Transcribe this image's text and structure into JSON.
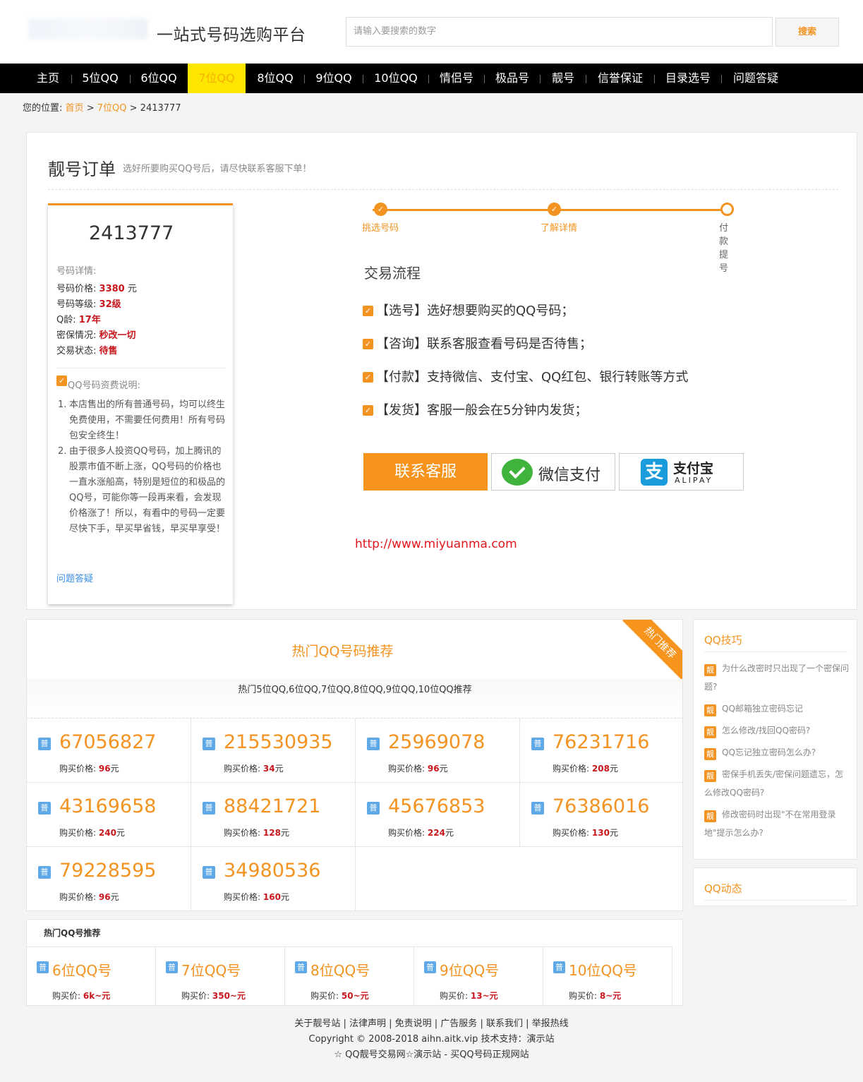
{
  "header": {
    "slogan": "一站式号码选购平台",
    "search_placeholder": "请输入要搜索的数字",
    "search_btn": "搜索"
  },
  "nav": [
    "主页",
    "5位QQ",
    "6位QQ",
    "7位QQ",
    "8位QQ",
    "9位QQ",
    "10位QQ",
    "情侣号",
    "极品号",
    "靓号",
    "信誉保证",
    "目录选号",
    "问题答疑"
  ],
  "nav_active": "7位QQ",
  "breadcrumb": {
    "prefix": "您的位置:",
    "home": "首页",
    "sep1": ">",
    "cat": "7位QQ",
    "sep2": ">",
    "current": "2413777"
  },
  "order": {
    "title": "靓号订单",
    "subtitle": "选好所要购买QQ号后，请尽快联系客服下单！",
    "number": "2413777",
    "detail_heading": "号码详情:",
    "details": [
      {
        "label": "号码价格:",
        "value": "3380",
        "suffix": " 元"
      },
      {
        "label": "号码等级:",
        "value": "32级",
        "suffix": ""
      },
      {
        "label": "Q龄:",
        "value": "17年",
        "suffix": ""
      },
      {
        "label": "密保情况:",
        "value": "秒改一切",
        "suffix": ""
      },
      {
        "label": "交易状态:",
        "value": "待售",
        "suffix": ""
      }
    ],
    "fee_title": "QQ号码资费说明:",
    "fee_items": [
      "本店售出的所有普通号码，均可以终生免费使用，不需要任何费用！所有号码包安全终生！",
      "由于很多人投资QQ号码，加上腾讯的股票市值不断上涨，QQ号码的价格也一直水涨船高，特别是短位的和极品的QQ号，可能你等一段再来看，会发现价格涨了！所以，有看中的号码一定要尽快下手，早买早省钱，早买早享受！"
    ],
    "faq_link": "问题答疑",
    "steps": [
      "挑选号码",
      "了解详情",
      "付款提号"
    ],
    "flow_title": "交易流程",
    "flow": [
      "【选号】选好想要购买的QQ号码；",
      "【咨询】联系客服查看号码是否待售；",
      "【付款】支持微信、支付宝、QQ红包、银行转账等方式",
      "【发货】客服一般会在5分钟内发货；"
    ],
    "contact_btn": "联系客服",
    "wechat_pay": "微信支付",
    "alipay_cn": "支付宝",
    "alipay_en": "ALIPAY",
    "alipay_glyph": "支",
    "url": "http://www.miyuanma.com"
  },
  "hot": {
    "title": "热门QQ号码推荐",
    "ribbon": "热门推荐",
    "subtitle": "热门5位QQ,6位QQ,7位QQ,8位QQ,9位QQ,10位QQ推荐",
    "badge": "普",
    "price_label": "购买价格:",
    "unit": "元",
    "items": [
      {
        "num": "67056827",
        "price": "96"
      },
      {
        "num": "215530935",
        "price": "34"
      },
      {
        "num": "25969078",
        "price": "96"
      },
      {
        "num": "76231716",
        "price": "208"
      },
      {
        "num": "43169658",
        "price": "240"
      },
      {
        "num": "88421721",
        "price": "128"
      },
      {
        "num": "45676853",
        "price": "224"
      },
      {
        "num": "76386016",
        "price": "130"
      },
      {
        "num": "79228595",
        "price": "96"
      },
      {
        "num": "34980536",
        "price": "160"
      }
    ]
  },
  "categories": {
    "heading": "热门QQ号推荐",
    "price_label": "购买价:",
    "items": [
      {
        "name": "6位QQ号",
        "price": "6k~元"
      },
      {
        "name": "7位QQ号",
        "price": "350~元"
      },
      {
        "name": "8位QQ号",
        "price": "50~元"
      },
      {
        "name": "9位QQ号",
        "price": "13~元"
      },
      {
        "name": "10位QQ号",
        "price": "8~元"
      }
    ]
  },
  "sidebar": {
    "tips_title": "QQ技巧",
    "tip_badge": "靓",
    "tips": [
      "为什么改密时只出现了一个密保问题?",
      "QQ邮箱独立密码忘记",
      "怎么修改/找回QQ密码?",
      "QQ忘记独立密码怎么办?",
      "密保手机丢失/密保问题遗忘，怎么修改QQ密码?",
      "修改密码时出现\"不在常用登录地\"提示怎么办?"
    ],
    "news_title": "QQ动态"
  },
  "footer": {
    "links": "关于靓号站 | 法律声明 | 免责说明 | 广告服务 | 联系我们 | 举报热线",
    "copyright": "Copyright © 2008-2018 aihn.aitk.vip 技术支持：演示站",
    "tagline": "☆ QQ靓号交易网☆演示站 - 买QQ号码正规网站"
  },
  "colors": {
    "accent": "#f39322",
    "nav_active": "#ffe600",
    "price_red": "#c7161c",
    "badge_blue": "#5fa9e8",
    "wechat_green": "#3fb33c",
    "alipay_blue": "#1a9cdc"
  }
}
